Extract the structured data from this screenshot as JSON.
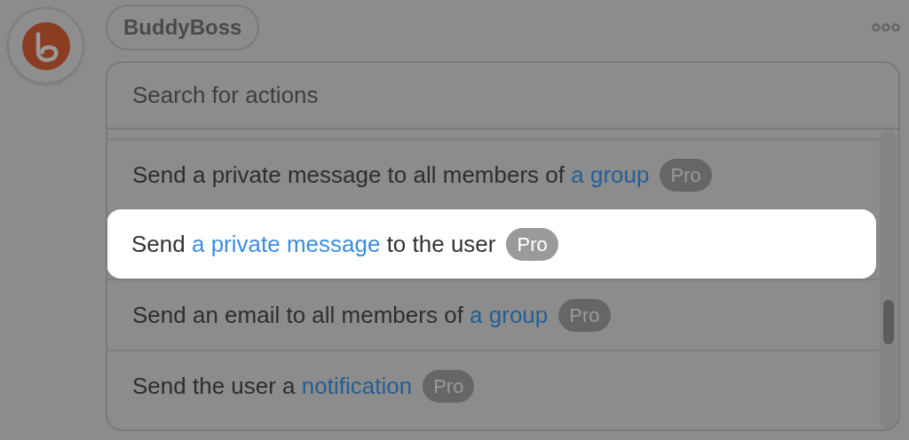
{
  "app_badge": "BuddyBoss",
  "search": {
    "placeholder": "Search for actions"
  },
  "actions": [
    {
      "parts": [
        {
          "text": "Send a private message to all members of ",
          "link": false
        },
        {
          "text": "a group",
          "link": true
        }
      ],
      "badge": "Pro",
      "selected": false
    },
    {
      "parts": [
        {
          "text": "Send ",
          "link": false
        },
        {
          "text": "a private message",
          "link": true
        },
        {
          "text": " to the user",
          "link": false
        }
      ],
      "badge": "Pro",
      "selected": true
    },
    {
      "parts": [
        {
          "text": "Send an email to all members of ",
          "link": false
        },
        {
          "text": "a group",
          "link": true
        }
      ],
      "badge": "Pro",
      "selected": false
    },
    {
      "parts": [
        {
          "text": "Send the user a ",
          "link": false
        },
        {
          "text": "notification",
          "link": true
        }
      ],
      "badge": "Pro",
      "selected": false
    }
  ]
}
